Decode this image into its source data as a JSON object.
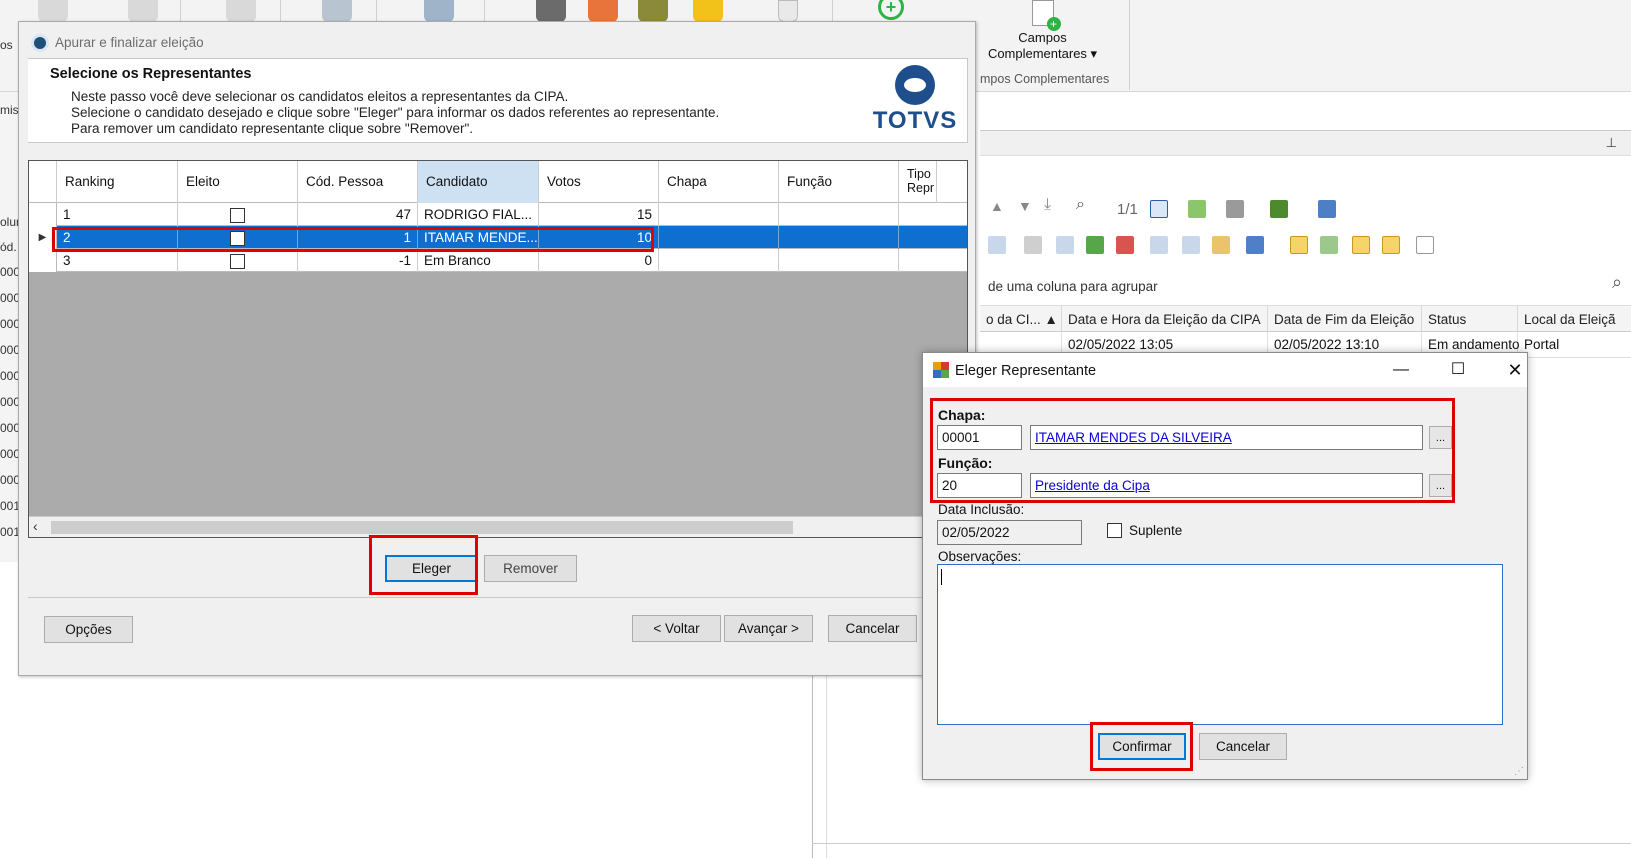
{
  "ribbon": {
    "campos_button_line1": "Campos",
    "campos_button_line2": "Complementares ▾",
    "group_label": "mpos Complementares"
  },
  "left_strip": {
    "items": [
      "os",
      "mis",
      "olur",
      "ód.",
      "000",
      "000",
      "000",
      "000",
      "000",
      "000",
      "000",
      "000",
      "000",
      "001",
      "001"
    ]
  },
  "bg_panel": {
    "pager": "1/1",
    "group_hint": "de uma coluna para agrupar",
    "columns": [
      "o da CI... ▲",
      "Data e Hora da Eleição da CIPA",
      "Data de Fim da Eleição",
      "Status",
      "Local da Eleiçã"
    ],
    "row": [
      "",
      "02/05/2022 13:05",
      "02/05/2022 13:10",
      "Em andamento",
      "Portal"
    ]
  },
  "wizard": {
    "title": "Apurar e finalizar eleição",
    "heading": "Selecione os Representantes",
    "lines": [
      "Neste passo você deve selecionar os candidatos eleitos a representantes da CIPA.",
      "Selecione o candidato desejado e clique sobre \"Eleger\" para informar os dados referentes ao representante.",
      "Para remover um candidato representante clique sobre \"Remover\"."
    ],
    "logo_text": "TOTVS",
    "grid": {
      "columns": [
        "Ranking",
        "Eleito",
        "Cód. Pessoa",
        "Candidato",
        "Votos",
        "Chapa",
        "Função",
        "Tipo Repr"
      ],
      "rows": [
        {
          "ranking": "1",
          "cod": "47",
          "candidato": "RODRIGO FIAL...",
          "votos": "15"
        },
        {
          "ranking": "2",
          "cod": "1",
          "candidato": "ITAMAR MENDE...",
          "votos": "10"
        },
        {
          "ranking": "3",
          "cod": "-1",
          "candidato": "Em Branco",
          "votos": "0"
        }
      ]
    },
    "buttons": {
      "eleger": "Eleger",
      "remover": "Remover",
      "opcoes": "Opções",
      "voltar": "< Voltar",
      "avancar": "Avançar >",
      "cancelar": "Cancelar"
    }
  },
  "dialog": {
    "title": "Eleger Representante",
    "chapa_label": "Chapa:",
    "chapa_code": "00001",
    "chapa_name": "ITAMAR MENDES DA SILVEIRA",
    "funcao_label": "Função:",
    "funcao_code": "20",
    "funcao_name": "Presidente da Cipa",
    "data_label": "Data Inclusão:",
    "data_value": "02/05/2022",
    "suplente_label": "Suplente",
    "obs_label": "Observações:",
    "ellipsis": "...",
    "confirmar": "Confirmar",
    "cancelar": "Cancelar"
  },
  "colors": {
    "selection": "#0f6fd1",
    "highlight_box": "#e00000",
    "link": "#0b00d6",
    "brand": "#1f4e8c"
  }
}
